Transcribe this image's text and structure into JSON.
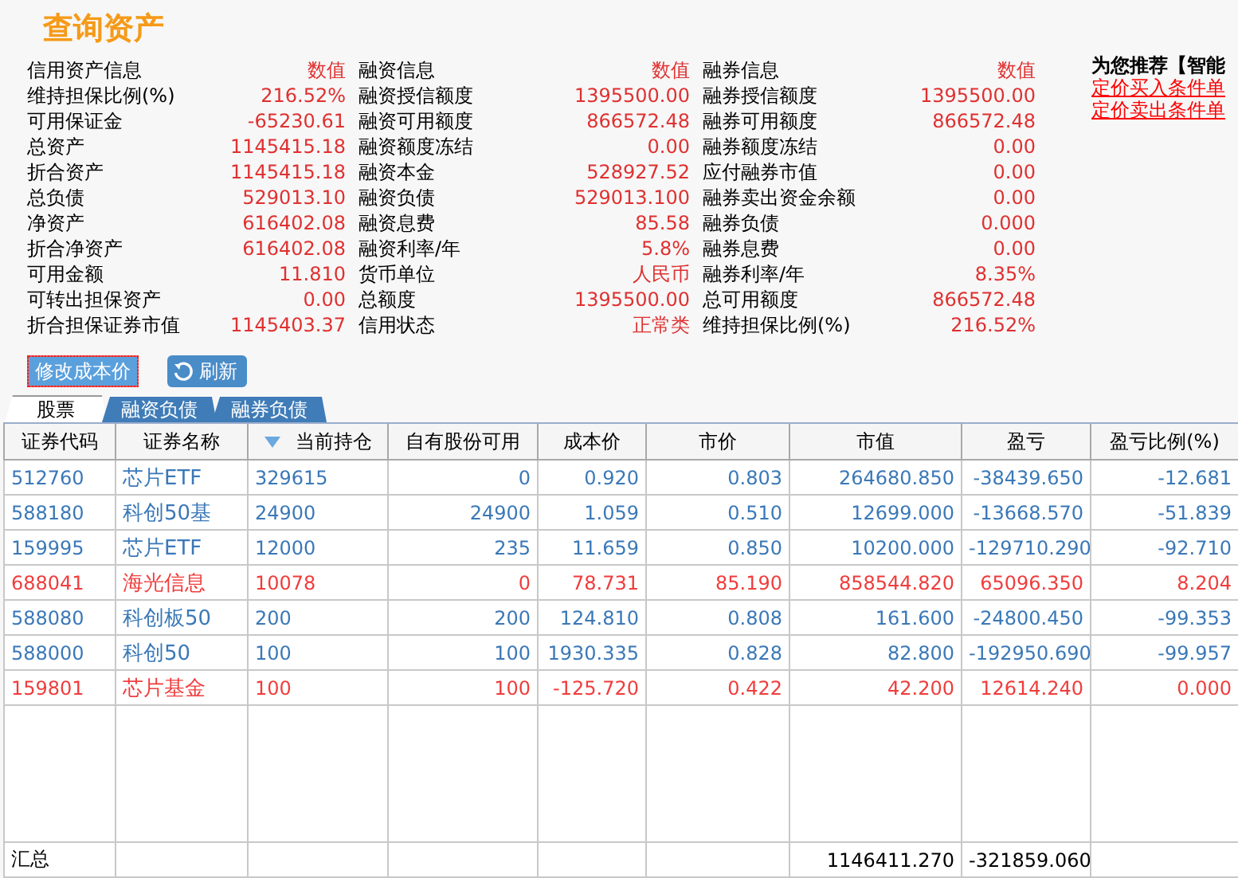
{
  "title": "查询资产",
  "info_groups": [
    {
      "heading": "信用资产信息",
      "value_heading": "数值",
      "items": [
        {
          "label": "维持担保比例(%)",
          "value": "216.52%"
        },
        {
          "label": "可用保证金",
          "value": "-65230.61"
        },
        {
          "label": "总资产",
          "value": "1145415.18"
        },
        {
          "label": "折合资产",
          "value": "1145415.18"
        },
        {
          "label": "总负债",
          "value": "529013.10"
        },
        {
          "label": "净资产",
          "value": "616402.08"
        },
        {
          "label": "折合净资产",
          "value": "616402.08"
        },
        {
          "label": "可用金额",
          "value": "11.810"
        },
        {
          "label": "可转出担保资产",
          "value": "0.00"
        },
        {
          "label": "折合担保证券市值",
          "value": "1145403.37"
        }
      ]
    },
    {
      "heading": "融资信息",
      "value_heading": "数值",
      "items": [
        {
          "label": "融资授信额度",
          "value": "1395500.00"
        },
        {
          "label": "融资可用额度",
          "value": "866572.48"
        },
        {
          "label": "融资额度冻结",
          "value": "0.00"
        },
        {
          "label": "融资本金",
          "value": "528927.52"
        },
        {
          "label": "融资负债",
          "value": "529013.100"
        },
        {
          "label": "融资息费",
          "value": "85.58"
        },
        {
          "label": "融资利率/年",
          "value": "5.8%"
        },
        {
          "label": "货币单位",
          "value": "人民币"
        },
        {
          "label": "总额度",
          "value": "1395500.00"
        },
        {
          "label": "信用状态",
          "value": "正常类"
        }
      ]
    },
    {
      "heading": "融券信息",
      "value_heading": "数值",
      "items": [
        {
          "label": "融券授信额度",
          "value": "1395500.00"
        },
        {
          "label": "融券可用额度",
          "value": "866572.48"
        },
        {
          "label": "融券额度冻结",
          "value": "0.00"
        },
        {
          "label": "应付融券市值",
          "value": "0.00"
        },
        {
          "label": "融券卖出资金余额",
          "value": "0.00"
        },
        {
          "label": "融券负债",
          "value": "0.000"
        },
        {
          "label": "融券息费",
          "value": "0.00"
        },
        {
          "label": "融券利率/年",
          "value": "8.35%"
        },
        {
          "label": "总可用额度",
          "value": "866572.48"
        },
        {
          "label": "维持担保比例(%)",
          "value": "216.52%"
        }
      ]
    }
  ],
  "promo": {
    "headline": "为您推荐【智能",
    "links": [
      "定价买入条件单",
      "定价卖出条件单"
    ]
  },
  "buttons": [
    {
      "kind": "focused",
      "label": "修改成本价"
    },
    {
      "kind": "refresh",
      "label": "刷新"
    }
  ],
  "tabs": [
    {
      "label": "股票",
      "selected": true
    },
    {
      "label": "融资负债",
      "selected": false
    },
    {
      "label": "融券负债",
      "selected": false
    }
  ],
  "table": {
    "columns": [
      {
        "label": "证券代码",
        "sorted": false
      },
      {
        "label": "证券名称",
        "sorted": false
      },
      {
        "label": "当前持仓",
        "sorted": true
      },
      {
        "label": "自有股份可用",
        "sorted": false
      },
      {
        "label": "成本价",
        "sorted": false
      },
      {
        "label": "市价",
        "sorted": false
      },
      {
        "label": "市值",
        "sorted": false
      },
      {
        "label": "盈亏",
        "sorted": false
      },
      {
        "label": "盈亏比例(%)",
        "sorted": false
      }
    ],
    "rows": [
      {
        "color": "#3a78b8",
        "cells": [
          "512760",
          "芯片ETF",
          "329615",
          "0",
          "0.920",
          "0.803",
          "264680.850",
          "-38439.650",
          "-12.681"
        ]
      },
      {
        "color": "#3a78b8",
        "cells": [
          "588180",
          "科创50基",
          "24900",
          "24900",
          "1.059",
          "0.510",
          "12699.000",
          "-13668.570",
          "-51.839"
        ]
      },
      {
        "color": "#3a78b8",
        "cells": [
          "159995",
          "芯片ETF",
          "12000",
          "235",
          "11.659",
          "0.850",
          "10200.000",
          "-129710.290",
          "-92.710"
        ]
      },
      {
        "color": "#f03c3c",
        "cells": [
          "688041",
          "海光信息",
          "10078",
          "0",
          "78.731",
          "85.190",
          "858544.820",
          "65096.350",
          "8.204"
        ]
      },
      {
        "color": "#3a78b8",
        "cells": [
          "588080",
          "科创板50",
          "200",
          "200",
          "124.810",
          "0.808",
          "161.600",
          "-24800.450",
          "-99.353"
        ]
      },
      {
        "color": "#3a78b8",
        "cells": [
          "588000",
          "科创50",
          "100",
          "100",
          "1930.335",
          "0.828",
          "82.800",
          "-192950.690",
          "-99.957"
        ]
      },
      {
        "color": "#f03c3c",
        "cells": [
          "159801",
          "芯片基金",
          "100",
          "100",
          "-125.720",
          "0.422",
          "42.200",
          "12614.240",
          "0.000"
        ]
      }
    ],
    "summary": {
      "label": "汇总",
      "market_value": "1146411.270",
      "profit_loss": "-321859.060"
    }
  }
}
